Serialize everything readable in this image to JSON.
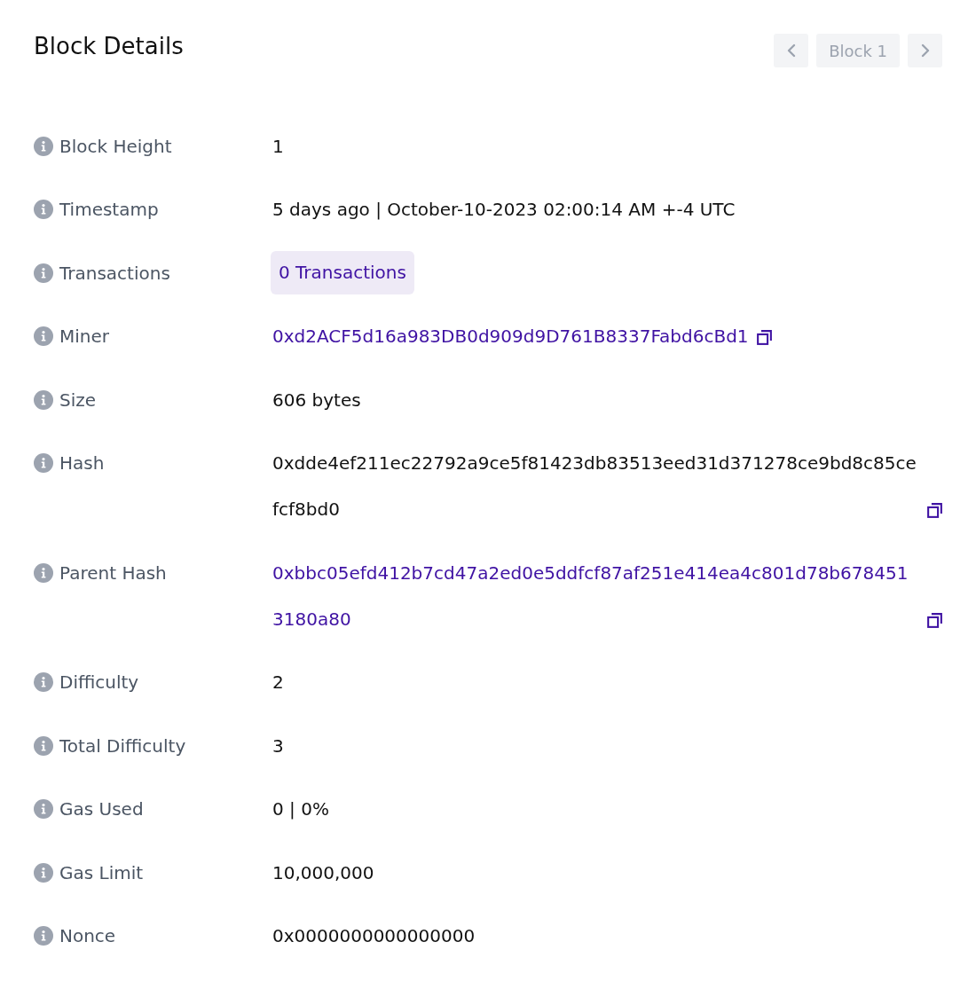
{
  "title": "Block Details",
  "nav": {
    "label": "Block 1"
  },
  "rows": [
    {
      "label": "Block Height",
      "value": "1",
      "kind": "text",
      "copyable": false
    },
    {
      "label": "Timestamp",
      "value": "5 days ago | October-10-2023 02:00:14 AM +-4 UTC",
      "kind": "text",
      "copyable": false
    },
    {
      "label": "Transactions",
      "value": "0 Transactions",
      "kind": "badge",
      "copyable": false
    },
    {
      "label": "Miner",
      "value": "0xd2ACF5d16a983DB0d909d9D761B8337Fabd6cBd1",
      "kind": "link",
      "copyable": true
    },
    {
      "label": "Size",
      "value": "606 bytes",
      "kind": "text",
      "copyable": false
    },
    {
      "label": "Hash",
      "value": "0xdde4ef211ec22792a9ce5f81423db83513eed31d371278ce9bd8c85cefcf8bd0",
      "kind": "text",
      "copyable": true
    },
    {
      "label": "Parent Hash",
      "value": "0xbbc05efd412b7cd47a2ed0e5ddfcf87af251e414ea4c801d78b6784513180a80",
      "kind": "link",
      "copyable": true
    },
    {
      "label": "Difficulty",
      "value": "2",
      "kind": "text",
      "copyable": false
    },
    {
      "label": "Total Difficulty",
      "value": "3",
      "kind": "text",
      "copyable": false
    },
    {
      "label": "Gas Used",
      "value": "0 | 0%",
      "kind": "text",
      "copyable": false
    },
    {
      "label": "Gas Limit",
      "value": "10,000,000",
      "kind": "text",
      "copyable": false
    },
    {
      "label": "Nonce",
      "value": "0x0000000000000000",
      "kind": "text",
      "copyable": false
    }
  ]
}
